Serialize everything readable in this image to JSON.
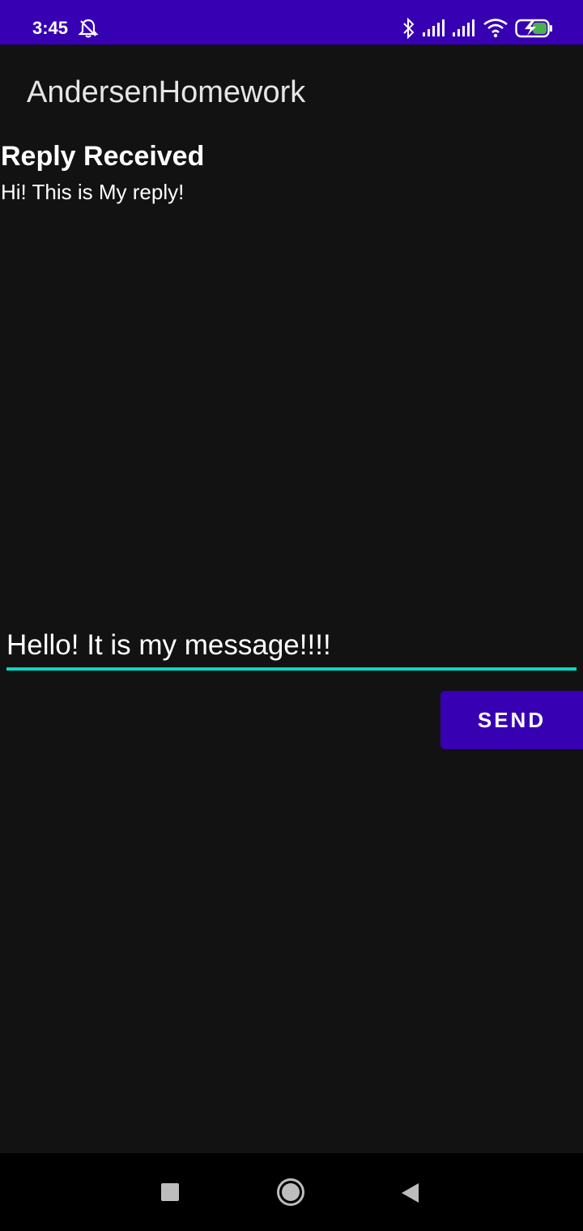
{
  "status_bar": {
    "time": "3:45",
    "icons": [
      "notifications-off-icon",
      "bluetooth-icon",
      "signal-icon",
      "signal-icon",
      "wifi-icon",
      "battery-charging-icon"
    ]
  },
  "app_bar": {
    "title": "AndersenHomework"
  },
  "reply": {
    "header": "Reply Received",
    "text": "Hi! This is My reply!"
  },
  "message": {
    "value": "Hello! It is my message!!!!"
  },
  "send_button": {
    "label": "SEND"
  },
  "nav_bar": {
    "icons": [
      "recents-icon",
      "home-icon",
      "back-icon"
    ]
  },
  "colors": {
    "primary": "#3700b3",
    "background": "#121212",
    "accent": "#03dac5"
  }
}
